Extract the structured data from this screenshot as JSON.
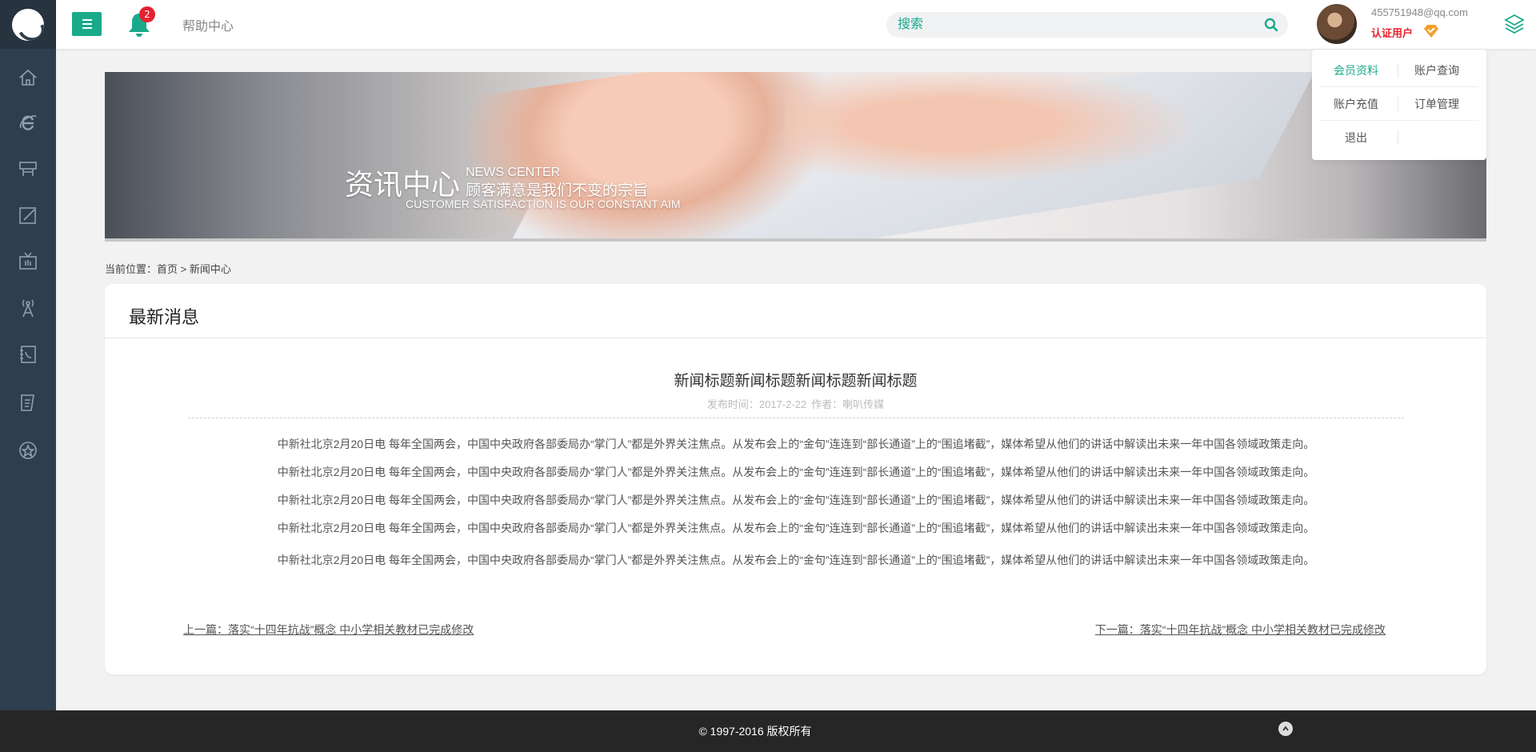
{
  "topbar": {
    "notification_count": "2",
    "help_label": "帮助中心",
    "search_placeholder": "搜索",
    "user_email": "455751948@qq.com",
    "user_status": "认证用户"
  },
  "user_menu": {
    "items": [
      "会员资料",
      "账户查询",
      "账户充值",
      "订单管理",
      "退出"
    ],
    "active_index": 0
  },
  "sidebar": {
    "icons": [
      "home-icon",
      "ie-icon",
      "signboard-icon",
      "edit-icon",
      "tv-icon",
      "antenna-icon",
      "phone-book-icon",
      "document-icon",
      "star-icon"
    ]
  },
  "banner": {
    "title": "资讯中心",
    "title_en": "NEWS CENTER",
    "subtitle": "顾客满意是我们不变的宗旨",
    "slogan_en": "CUSTOMER SATISFACTION IS OUR CONSTANT AIM"
  },
  "breadcrumb": {
    "prefix": "当前位置：",
    "home": "首页",
    "separator": ">",
    "current": "新闻中心"
  },
  "article_box": {
    "header": "最新消息",
    "title": "新闻标题新闻标题新闻标题新闻标题",
    "publish_time": "发布时间：2017-2-22",
    "author": "作者：喇叭传媒",
    "paragraphs": [
      "中新社北京2月20日电 每年全国两会，中国中央政府各部委局办“掌门人”都是外界关注焦点。从发布会上的“金句”连连到“部长通道”上的“围追堵截”，媒体希望从他们的讲话中解读出未来一年中国各领域政策走向。",
      "中新社北京2月20日电 每年全国两会，中国中央政府各部委局办“掌门人”都是外界关注焦点。从发布会上的“金句”连连到“部长通道”上的“围追堵截”，媒体希望从他们的讲话中解读出未来一年中国各领域政策走向。",
      "中新社北京2月20日电 每年全国两会，中国中央政府各部委局办“掌门人”都是外界关注焦点。从发布会上的“金句”连连到“部长通道”上的“围追堵截”，媒体希望从他们的讲话中解读出未来一年中国各领域政策走向。",
      "中新社北京2月20日电 每年全国两会，中国中央政府各部委局办“掌门人”都是外界关注焦点。从发布会上的“金句”连连到“部长通道”上的“围追堵截”，媒体希望从他们的讲话中解读出未来一年中国各领域政策走向。",
      "中新社北京2月20日电 每年全国两会，中国中央政府各部委局办“掌门人”都是外界关注焦点。从发布会上的“金句”连连到“部长通道”上的“围追堵截”，媒体希望从他们的讲话中解读出未来一年中国各领域政策走向。"
    ],
    "prev": "上一篇：落实“十四年抗战”概念 中小学相关教材已完成修改",
    "next": "下一篇：落实“十四年抗战”概念 中小学相关教材已完成修改"
  },
  "footer": {
    "copyright": "© 1997-2016 版权所有"
  },
  "colors": {
    "accent": "#1aaa8a",
    "sidebar_bg": "#2f3e4d",
    "badge": "#e5222f",
    "footer_bg": "#262626"
  }
}
